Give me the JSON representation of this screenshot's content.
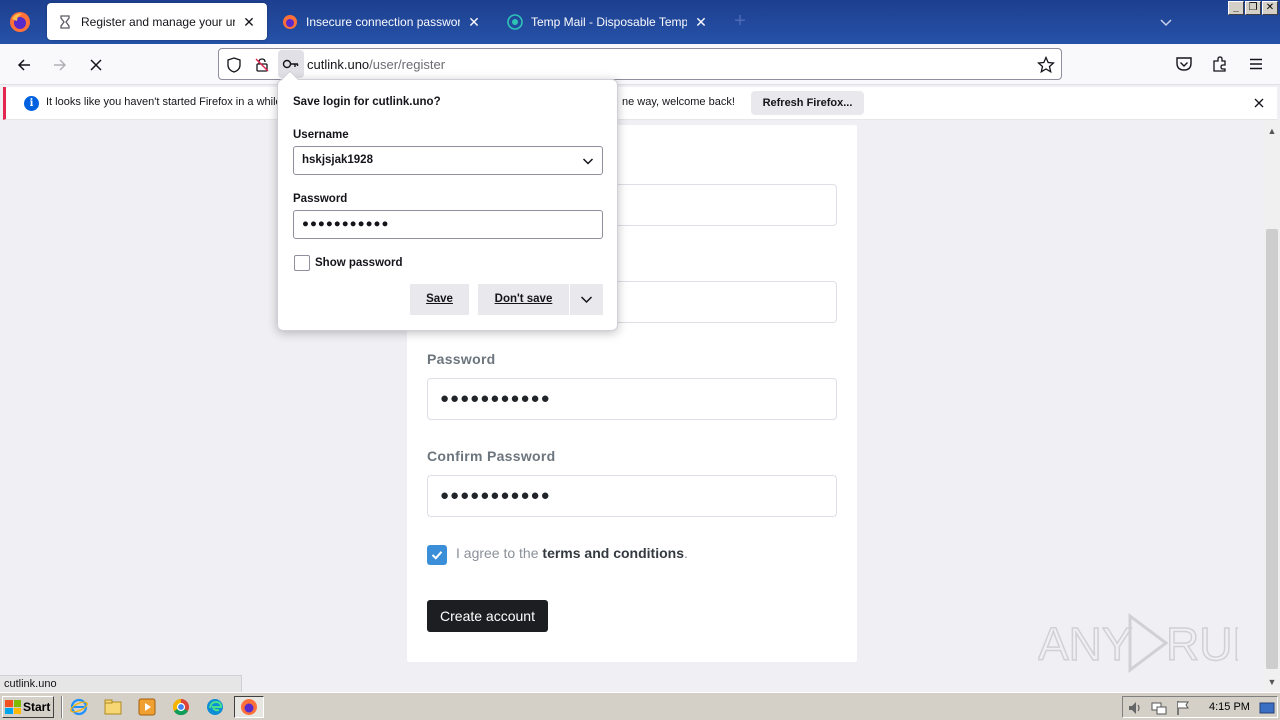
{
  "window": {
    "tabs": [
      {
        "title": "Register and manage your urls. -",
        "icon": "hourglass-icon",
        "active": true
      },
      {
        "title": "Insecure connection password war",
        "icon": "firefox-icon",
        "active": false
      },
      {
        "title": "Temp Mail - Disposable Temporary E",
        "icon": "tempmail-icon",
        "active": false
      }
    ],
    "controls": {
      "minimize": "_",
      "restore": "❐",
      "close": "✕"
    }
  },
  "navbar": {
    "url_domain": "cutlink.uno",
    "url_path": "/user/register"
  },
  "notification": {
    "text_left": "It looks like you haven't started Firefox in a while",
    "text_right": "ne way, welcome back!",
    "button": "Refresh Firefox..."
  },
  "save_login_popup": {
    "title": "Save login for cutlink.uno?",
    "username_label": "Username",
    "username_value": "hskjsjak1928",
    "password_label": "Password",
    "password_value": "●●●●●●●●●●●",
    "show_password_label": "Show password",
    "save_button": "Save",
    "dont_save_button": "Don't save"
  },
  "form": {
    "password_label": "Password",
    "password_value": "●●●●●●●●●●●",
    "confirm_label": "Confirm Password",
    "confirm_value": "●●●●●●●●●●●",
    "agree_prefix": "I agree to the ",
    "agree_link": "terms and conditions",
    "agree_suffix": ".",
    "create_button": "Create account"
  },
  "status_url": "cutlink.uno",
  "watermark": "ANY RUN",
  "taskbar": {
    "start": "Start",
    "clock": "4:15 PM"
  },
  "colors": {
    "accent_blue": "#3b8ed8",
    "button_dark": "#1c1e21",
    "notification_stripe": "#e22850"
  }
}
